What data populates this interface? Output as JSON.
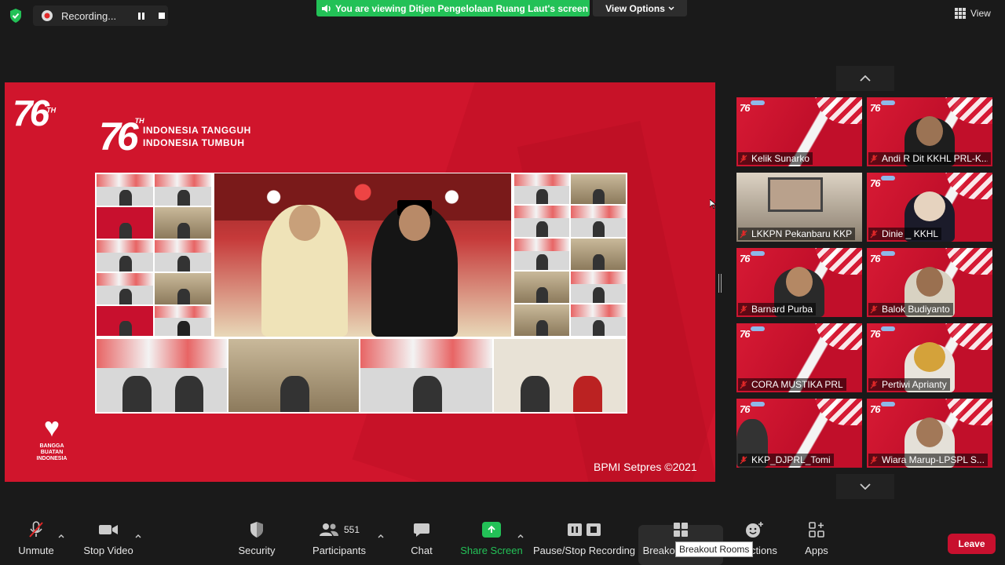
{
  "topbar": {
    "recording_label": "Recording...",
    "viewing_banner": "You are viewing Ditjen Pengelolaan Ruang Laut's screen",
    "view_options_label": "View Options",
    "view_label": "View"
  },
  "share": {
    "logo_small": "76",
    "logo_small_th": "TH",
    "logo_main": "76",
    "logo_main_th": "TH",
    "tagline_1": "INDONESIA TANGGUH",
    "tagline_2": "INDONESIA TUMBUH",
    "bangga_1": "BANGGA BUATAN",
    "bangga_2": "INDONESIA",
    "copyright": "BPMI Setpres ©2021"
  },
  "participants": [
    {
      "name": "Kelik Sunarko"
    },
    {
      "name": "Andi R Dit KKHL PRL-K..."
    },
    {
      "name": "LKKPN Pekanbaru KKP"
    },
    {
      "name": "Dinie _ KKHL"
    },
    {
      "name": "Barnard Purba"
    },
    {
      "name": "Balok Budiyanto"
    },
    {
      "name": "CORA MUSTIKA PRL"
    },
    {
      "name": "Pertiwi Aprianty"
    },
    {
      "name": "KKP_DJPRL_Tomi"
    },
    {
      "name": "Wiara Marup-LPSPL S..."
    }
  ],
  "toolbar": {
    "unmute": "Unmute",
    "stop_video": "Stop Video",
    "security": "Security",
    "participants": "Participants",
    "participant_count": "551",
    "chat": "Chat",
    "share_screen": "Share Screen",
    "pause_stop_recording": "Pause/Stop Recording",
    "breakout_rooms": "Breakout Rooms",
    "breakout_tooltip": "Breakout Rooms",
    "reactions": "Reactions",
    "apps": "Apps",
    "leave": "Leave"
  },
  "colors": {
    "accent_green": "#23c157",
    "leave_red": "#c8102e",
    "share_red": "#d0152c",
    "mute_red": "#e02828"
  }
}
